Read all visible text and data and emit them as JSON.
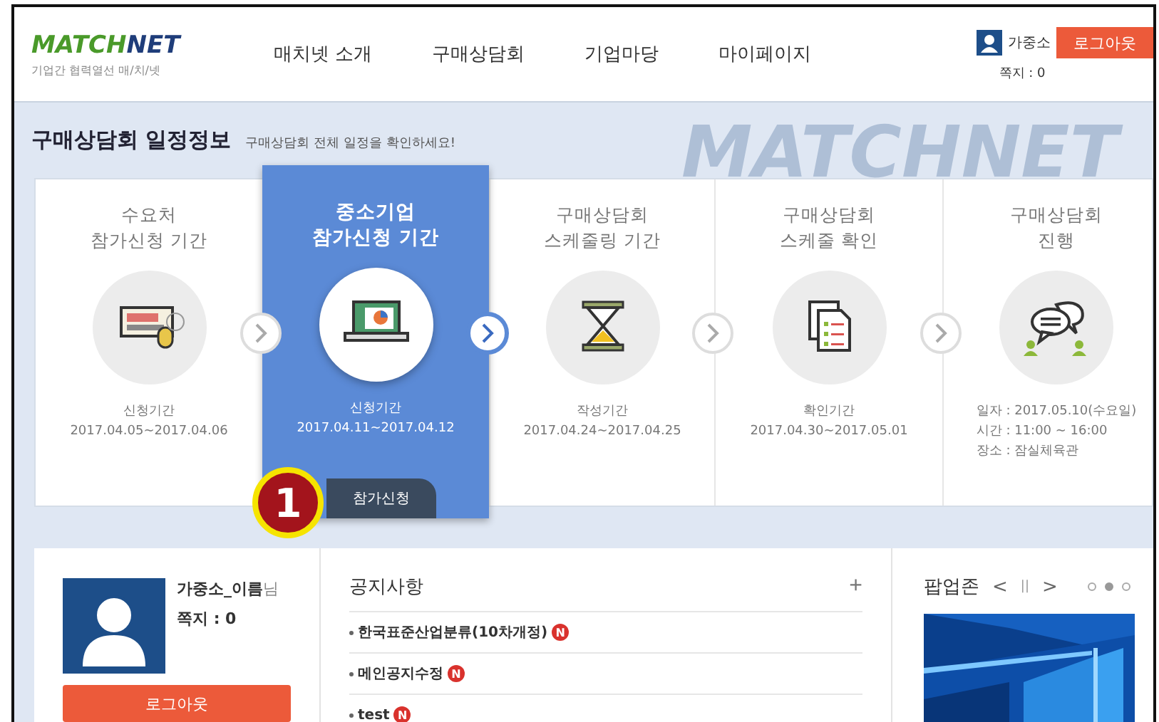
{
  "header": {
    "logo": [
      "MATCH",
      "NET"
    ],
    "tagline": "기업간 협력열선 매/치/넷",
    "nav": [
      {
        "label": "매치넷 소개"
      },
      {
        "label": "구매상담회"
      },
      {
        "label": "기업마당"
      },
      {
        "label": "마이페이지"
      }
    ],
    "user": {
      "name": "가중소",
      "logout": "로그아웃",
      "messages": "쪽지 : 0"
    }
  },
  "schedule": {
    "title": "구매상담회 일정정보",
    "subtitle": "구매상담회 전체 일정을 확인하세요!",
    "background_logo": "MATCHNET",
    "callout": "1",
    "steps": [
      {
        "title": [
          "수요처",
          "참가신청 기간"
        ],
        "kind": "keyboard",
        "selected": false,
        "lines": [
          "신청기간",
          "2017.04.05~2017.04.06"
        ]
      },
      {
        "title": [
          "중소기업",
          "참가신청 기간"
        ],
        "kind": "laptop",
        "selected": true,
        "lines": [
          "신청기간",
          "2017.04.11~2017.04.12"
        ],
        "button": "참가신청"
      },
      {
        "title": [
          "구매상담회",
          "스케줄링 기간"
        ],
        "kind": "hourglass",
        "selected": false,
        "lines": [
          "작성기간",
          "2017.04.24~2017.04.25"
        ]
      },
      {
        "title": [
          "구매상담회",
          "스케줄 확인"
        ],
        "kind": "documents",
        "selected": false,
        "lines": [
          "확인기간",
          "2017.04.30~2017.05.01"
        ]
      },
      {
        "title": [
          "구매상담회",
          "진행"
        ],
        "kind": "chat",
        "selected": false,
        "lines": [
          "일자 : 2017.05.10(수요일)",
          "시간 : 11:00 ~ 16:00",
          "장소 : 잠실체육관"
        ]
      }
    ]
  },
  "profile": {
    "name": "가중소_이름",
    "suffix": "님",
    "messages": "쪽지 : 0",
    "logout": "로그아웃"
  },
  "notices": {
    "title": "공지사항",
    "more": "+",
    "items": [
      {
        "text": "한국표준산업분류(10차개정)",
        "new": true,
        "badge": "N"
      },
      {
        "text": "메인공지수정",
        "new": true,
        "badge": "N"
      },
      {
        "text": "test",
        "new": true,
        "badge": "N"
      }
    ]
  },
  "popup_zone": {
    "title": "팝업존",
    "prev": "<",
    "pause": "||",
    "next": ">",
    "dots": [
      {
        "selected": false
      },
      {
        "selected": true
      },
      {
        "selected": false
      }
    ]
  }
}
